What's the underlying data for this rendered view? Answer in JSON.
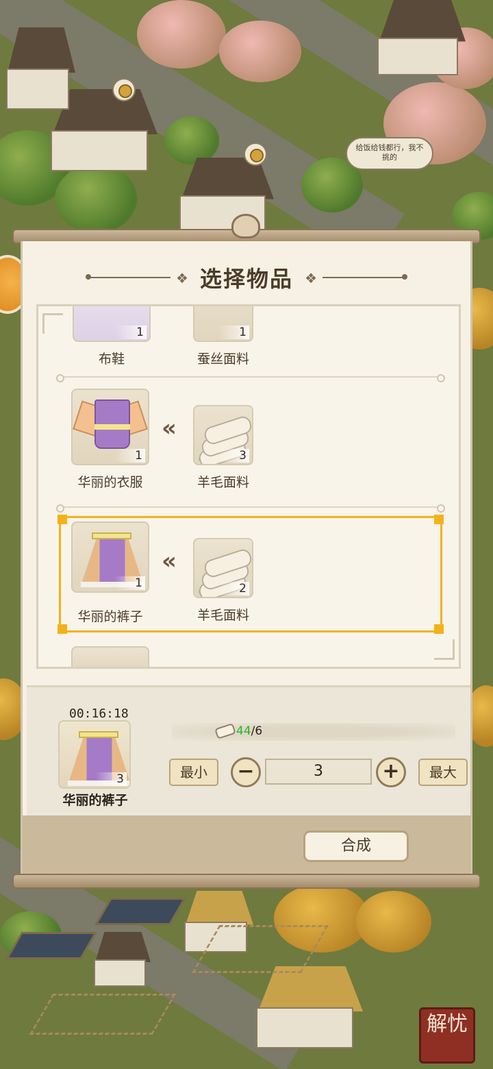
{
  "world": {
    "speech_bubble": "给饭给钱都行，我不挑的",
    "corner_badge": "解忧"
  },
  "dialog": {
    "title": "选择物品",
    "recipes": [
      {
        "output": {
          "name": "布鞋",
          "count": "1"
        },
        "material": {
          "name": "蚕丝面料",
          "count": "1"
        }
      },
      {
        "output": {
          "name": "华丽的衣服",
          "count": "1"
        },
        "material": {
          "name": "羊毛面料",
          "count": "3"
        }
      },
      {
        "output": {
          "name": "华丽的裤子",
          "count": "1"
        },
        "material": {
          "name": "羊毛面料",
          "count": "2"
        },
        "selected": true
      }
    ],
    "craft": {
      "timer": "00:16:18",
      "result_name": "华丽的裤子",
      "result_count": "3",
      "material_have": "44",
      "material_need": "/6",
      "min_label": "最小",
      "max_label": "最大",
      "minus_label": "−",
      "plus_label": "+",
      "quantity": "3"
    },
    "confirm_label": "合成"
  },
  "colors": {
    "selection": "#f3b21b",
    "have_ok": "#27b42a"
  }
}
